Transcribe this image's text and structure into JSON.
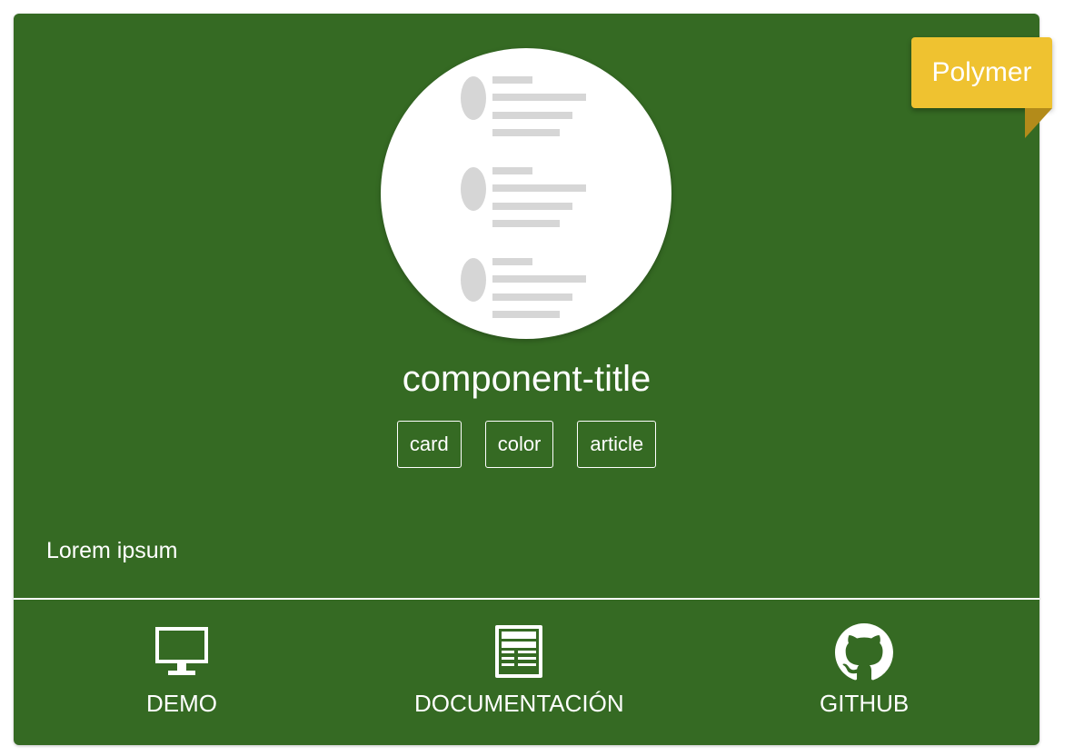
{
  "card": {
    "title": "component-title",
    "tags": [
      "card",
      "color",
      "article"
    ],
    "description": "Lorem ipsum",
    "badge": "Polymer"
  },
  "actions": [
    {
      "label": "DEMO",
      "icon": "monitor-icon"
    },
    {
      "label": "DOCUMENTACIÓN",
      "icon": "newspaper-icon"
    },
    {
      "label": "GITHUB",
      "icon": "github-icon"
    }
  ],
  "colors": {
    "card_background": "#356a23",
    "badge_background": "#efc230",
    "text": "#ffffff"
  }
}
